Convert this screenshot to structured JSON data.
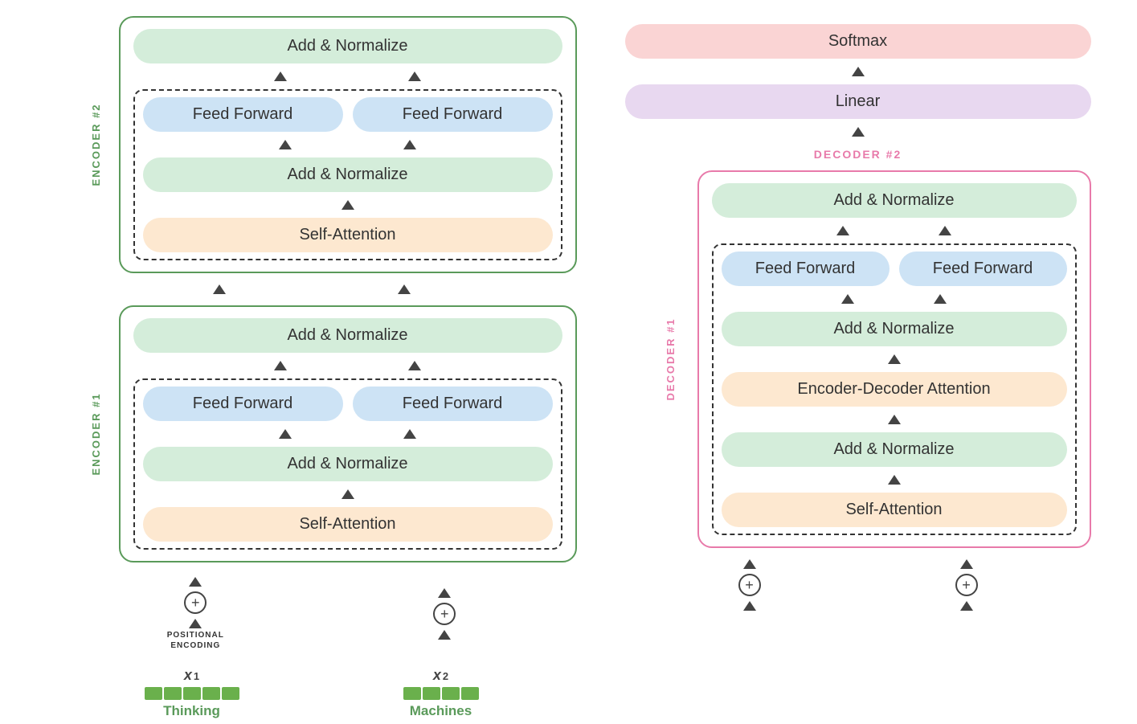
{
  "encoder": {
    "label1": "ENCODER #1",
    "label2": "ENCODER #2",
    "blocks": {
      "addNormalize": "Add & Normalize",
      "feedForward": "Feed Forward",
      "selfAttention": "Self-Attention"
    }
  },
  "decoder": {
    "label1": "DECODER #1",
    "label2": "DECODER #2",
    "blocks": {
      "addNormalize": "Add & Normalize",
      "feedForward": "Feed Forward",
      "selfAttention": "Self-Attention",
      "encoderDecoder": "Encoder-Decoder Attention",
      "linear": "Linear",
      "softmax": "Softmax"
    }
  },
  "inputs": {
    "x1_label": "x",
    "x1_sub": "1",
    "x2_label": "x",
    "x2_sub": "2",
    "word1": "Thinking",
    "word2": "Machines"
  },
  "labels": {
    "positionalEncoding": "POSITIONAL\nENCODING"
  }
}
